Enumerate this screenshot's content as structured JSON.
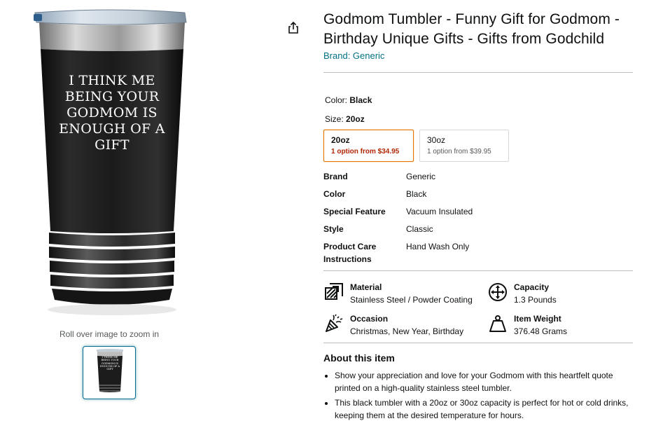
{
  "product": {
    "title": "Godmom Tumbler - Funny Gift for Godmom - Birthday Unique Gifts - Gifts from Godchild",
    "brand_link": "Brand: Generic",
    "image_quote": "I THINK ME BEING YOUR GODMOM IS ENOUGH OF A GIFT",
    "zoom_hint": "Roll over image to zoom in"
  },
  "variation": {
    "color_label": "Color:",
    "color_value": "Black",
    "size_label": "Size:",
    "size_value": "20oz",
    "options": [
      {
        "size": "20oz",
        "price": "1 option from $34.95",
        "selected": true
      },
      {
        "size": "30oz",
        "price": "1 option from $39.95",
        "selected": false
      }
    ]
  },
  "specs": [
    {
      "key": "Brand",
      "value": "Generic"
    },
    {
      "key": "Color",
      "value": "Black"
    },
    {
      "key": "Special Feature",
      "value": "Vacuum Insulated"
    },
    {
      "key": "Style",
      "value": "Classic"
    },
    {
      "key": "Product Care Instructions",
      "value": "Hand Wash Only"
    }
  ],
  "features": [
    {
      "icon": "material-icon",
      "title": "Material",
      "value": "Stainless Steel / Powder Coating"
    },
    {
      "icon": "capacity-icon",
      "title": "Capacity",
      "value": "1.3 Pounds"
    },
    {
      "icon": "occasion-icon",
      "title": "Occasion",
      "value": "Christmas, New Year, Birthday"
    },
    {
      "icon": "weight-icon",
      "title": "Item Weight",
      "value": "376.48 Grams"
    }
  ],
  "about": {
    "heading": "About this item",
    "bullets": [
      "Show your appreciation and love for your Godmom with this heartfelt quote printed on a high-quality stainless steel tumbler.",
      "This black tumbler with a 20oz or 30oz capacity is perfect for hot or cold drinks, keeping them at the desired temperature for hours."
    ]
  },
  "colors": {
    "link": "#007185",
    "selected_border": "#e77600",
    "price_red": "#b12704",
    "tumbler_body": "#1a1a1a"
  }
}
